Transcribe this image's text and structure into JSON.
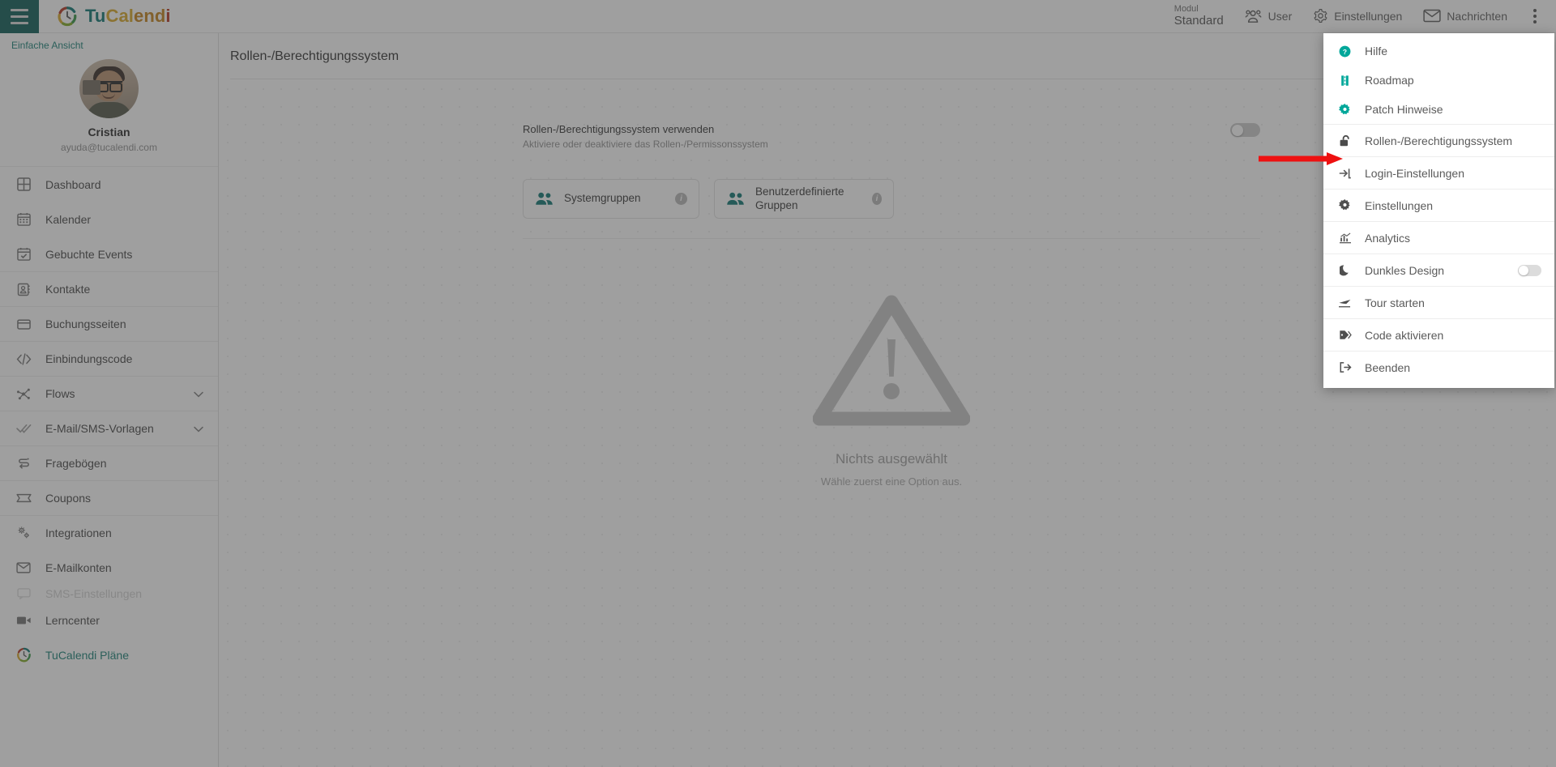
{
  "topbar": {
    "menu_icon": "hamburger-icon",
    "brand": {
      "tu": "Tu",
      "cal": "Cal",
      "end": "end",
      "i": "i"
    },
    "modul_label": "Modul",
    "modul_value": "Standard",
    "nav": [
      {
        "label": "User",
        "icon": "users-icon"
      },
      {
        "label": "Einstellungen",
        "icon": "gear-icon"
      },
      {
        "label": "Nachrichten",
        "icon": "envelope-icon"
      }
    ],
    "kebab_icon": "more-vertical-icon"
  },
  "sidebar": {
    "simple_view": "Einfache Ansicht",
    "profile": {
      "name": "Cristian",
      "email": "ayuda@tucalendi.com",
      "avatar": "user-avatar"
    },
    "items": [
      {
        "label": "Dashboard",
        "icon": "dashboard-icon",
        "separator": false,
        "chevron": false
      },
      {
        "label": "Kalender",
        "icon": "calendar-icon",
        "separator": false,
        "chevron": false
      },
      {
        "label": "Gebuchte Events",
        "icon": "calendar-check-icon",
        "separator": false,
        "chevron": false
      },
      {
        "label": "Kontakte",
        "icon": "contacts-icon",
        "separator": true,
        "chevron": false
      },
      {
        "label": "Buchungsseiten",
        "icon": "window-icon",
        "separator": true,
        "chevron": false
      },
      {
        "label": "Einbindungscode",
        "icon": "code-icon",
        "separator": true,
        "chevron": false
      },
      {
        "label": "Flows",
        "icon": "flow-nodes-icon",
        "separator": true,
        "chevron": true
      },
      {
        "label": "E-Mail/SMS-Vorlagen",
        "icon": "double-check-icon",
        "separator": true,
        "chevron": true
      },
      {
        "label": "Fragebögen",
        "icon": "survey-icon",
        "separator": true,
        "chevron": false
      },
      {
        "label": "Coupons",
        "icon": "ticket-icon",
        "separator": true,
        "chevron": false
      },
      {
        "label": "Integrationen",
        "icon": "gears-icon",
        "separator": true,
        "chevron": false
      },
      {
        "label": "E-Mailkonten",
        "icon": "mail-icon",
        "separator": false,
        "chevron": false
      },
      {
        "label": "SMS-Einstellungen",
        "icon": "sms-icon",
        "separator": false,
        "chevron": false,
        "clipped": true
      },
      {
        "label": "Lerncenter",
        "icon": "video-icon",
        "separator": false,
        "chevron": false
      },
      {
        "label": "TuCalendi Pläne",
        "icon": "tucalendi-logo-icon",
        "separator": false,
        "chevron": false,
        "accent": true
      }
    ]
  },
  "main": {
    "page_title": "Rollen-/Berechtigungssystem",
    "toggle": {
      "title": "Rollen-/Berechtigungssystem verwenden",
      "subtitle": "Aktiviere oder deaktiviere das Rollen-/Permissonssystem",
      "state": "off"
    },
    "cards": [
      {
        "label": "Systemgruppen",
        "icon": "group-icon",
        "info": "i"
      },
      {
        "label": "Benutzerdefinierte Gruppen",
        "icon": "group-icon",
        "info": "i"
      }
    ],
    "empty_state": {
      "icon": "warning-triangle-icon",
      "title": "Nichts ausgewählt",
      "subtitle": "Wähle zuerst eine Option aus."
    }
  },
  "menu": {
    "items": [
      {
        "label": "Hilfe",
        "icon": "help-circle-icon",
        "separator": false,
        "accent": true
      },
      {
        "label": "Roadmap",
        "icon": "roadmap-icon",
        "separator": false,
        "accent": true
      },
      {
        "label": "Patch Hinweise",
        "icon": "gear-icon",
        "separator": false,
        "accent": true
      },
      {
        "label": "Rollen-/Berechtigungssystem",
        "icon": "unlock-icon",
        "separator": true,
        "accent": false
      },
      {
        "label": "Login-Einstellungen",
        "icon": "login-icon",
        "separator": true,
        "accent": false
      },
      {
        "label": "Einstellungen",
        "icon": "gear-icon",
        "separator": true,
        "accent": false
      },
      {
        "label": "Analytics",
        "icon": "analytics-icon",
        "separator": true,
        "accent": false
      },
      {
        "label": "Dunkles Design",
        "icon": "moon-icon",
        "separator": true,
        "accent": false,
        "toggle": "off"
      },
      {
        "label": "Tour starten",
        "icon": "plane-icon",
        "separator": true,
        "accent": false
      },
      {
        "label": "Code aktivieren",
        "icon": "tag-icon",
        "separator": true,
        "accent": false
      },
      {
        "label": "Beenden",
        "icon": "logout-icon",
        "separator": true,
        "accent": false
      }
    ]
  },
  "annotation": {
    "arrow": "red-arrow-pointing-right",
    "color": "#ee1111"
  },
  "colors": {
    "brand_teal": "#00706b",
    "header_teal": "#00544e",
    "accent_green": "#0d7a6f",
    "arrow_red": "#ee1111"
  }
}
